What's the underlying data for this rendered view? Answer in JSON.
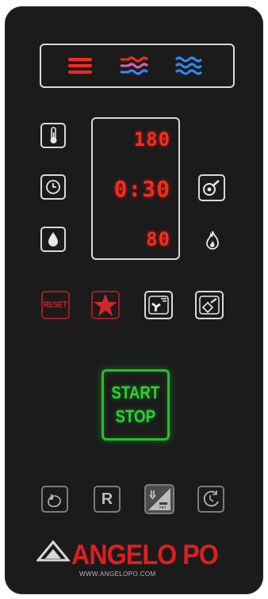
{
  "display": {
    "temperature": "180",
    "time": "0:30",
    "humidity": "80"
  },
  "buttons": {
    "reset_label": "RESET",
    "start_label": "START",
    "stop_label": "STOP",
    "recipe_label": "R"
  },
  "modes": [
    "convection-heat-icon",
    "combi-steam-icon",
    "steam-icon"
  ],
  "brand": {
    "name": "ANGELO PO",
    "url": "WWW.ANGELOPO.COM"
  },
  "colors": {
    "panel": "#1b1b1c",
    "led_red": "#ff2a1a",
    "start_green": "#22c22a",
    "brand_red": "#dd1f1f",
    "outline": "#d9d9d9"
  }
}
